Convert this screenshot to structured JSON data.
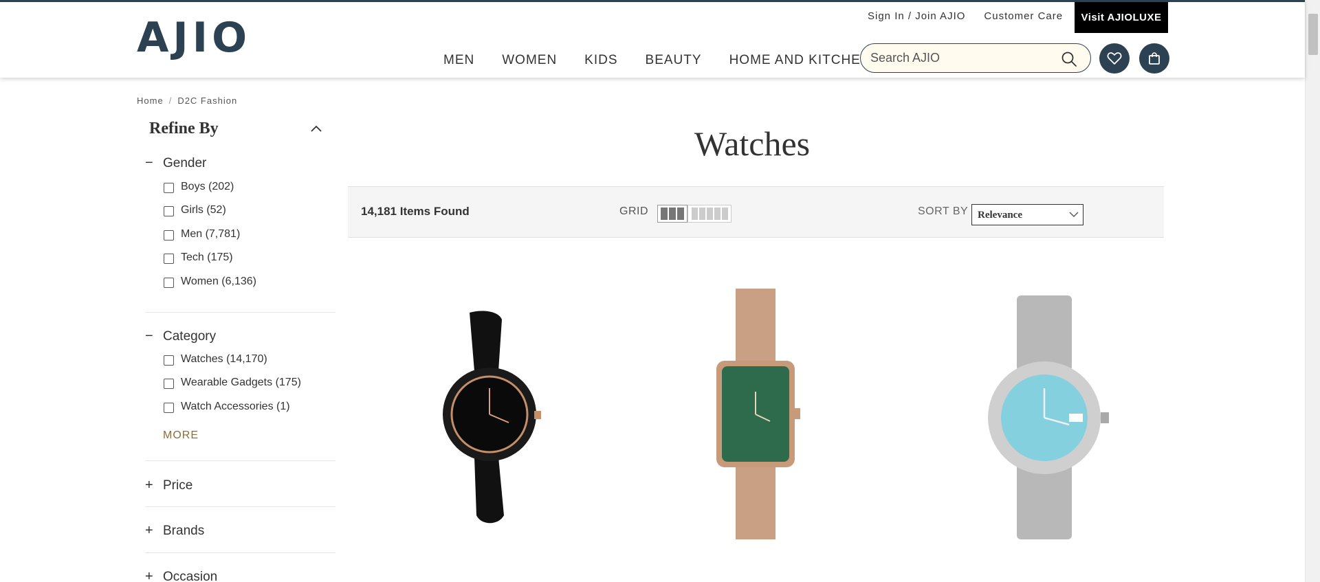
{
  "header": {
    "logo": "AJIO",
    "top_links": [
      "Sign In / Join AJIO",
      "Customer Care"
    ],
    "luxe_button": "Visit AJIOLUXE",
    "nav": [
      "MEN",
      "WOMEN",
      "KIDS",
      "BEAUTY",
      "HOME AND KITCHEN"
    ],
    "search_placeholder": "Search AJIO"
  },
  "breadcrumb": [
    "Home",
    "D2C Fashion"
  ],
  "sidebar": {
    "title": "Refine By",
    "gender": {
      "title": "Gender",
      "options": [
        "Boys (202)",
        "Girls (52)",
        "Men (7,781)",
        "Tech (175)",
        "Women (6,136)"
      ]
    },
    "category": {
      "title": "Category",
      "options": [
        "Watches (14,170)",
        "Wearable Gadgets (175)",
        "Watch Accessories (1)"
      ],
      "more": "MORE"
    },
    "collapsed": [
      "Price",
      "Brands",
      "Occasion"
    ]
  },
  "main": {
    "title": "Watches",
    "count": "14,181 Items Found",
    "grid_label": "GRID",
    "sort_label": "SORT BY",
    "sort_value": "Relevance"
  },
  "colors": {
    "brand": "#2c4152",
    "accent_more": "#8a6d3b"
  }
}
